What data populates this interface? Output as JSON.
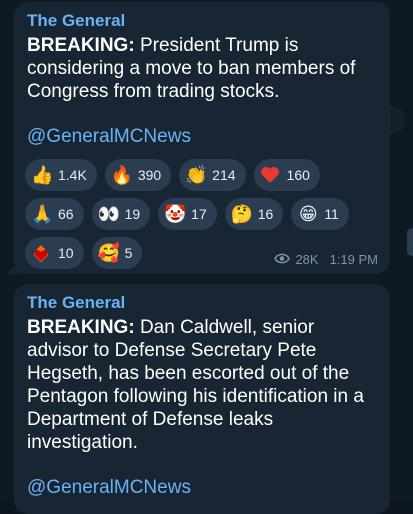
{
  "messages": [
    {
      "sender": "The General",
      "bold_prefix": "BREAKING:",
      "text": " President Trump is considering a move to ban members of Congress from trading stocks.",
      "link": "@GeneralMCNews",
      "reactions_row1": [
        {
          "icon": "thumbs-up-icon",
          "glyph": "👍",
          "count": "1.4K"
        },
        {
          "icon": "fire-icon",
          "glyph": "🔥",
          "count": "390"
        },
        {
          "icon": "clapping-hands-icon",
          "glyph": "👏",
          "count": "214"
        },
        {
          "icon": "heart-icon",
          "glyph": "❤",
          "count": "160"
        }
      ],
      "reactions_row2": [
        {
          "icon": "praying-hands-icon",
          "glyph": "🙏",
          "count": "66"
        },
        {
          "icon": "eyes-icon",
          "glyph": "👀",
          "count": "19"
        },
        {
          "icon": "clown-face-icon",
          "glyph": "🤡",
          "count": "17"
        },
        {
          "icon": "thinking-face-icon",
          "glyph": "🤔",
          "count": "16"
        },
        {
          "icon": "grinning-face-icon",
          "glyph": "😁",
          "count": "11"
        }
      ],
      "reactions_row3": [
        {
          "icon": "heart-on-fire-icon",
          "glyph": "❤",
          "count": "10"
        },
        {
          "icon": "smiling-hearts-face-icon",
          "glyph": "🥰",
          "count": "5"
        }
      ],
      "views": "28K",
      "time": "1:19 PM"
    },
    {
      "sender": "The General",
      "bold_prefix": "BREAKING:",
      "text": " Dan Caldwell, senior advisor to Defense Secretary Pete Hegseth, has been escorted out of the Pentagon following his identification in a Department of Defense leaks investigation.",
      "link": "@GeneralMCNews"
    }
  ],
  "colors": {
    "background": "#0e1621",
    "bubble": "#182533",
    "accent": "#6ab3f3",
    "chip": "#2b3d50",
    "meta": "#7f93a7"
  }
}
